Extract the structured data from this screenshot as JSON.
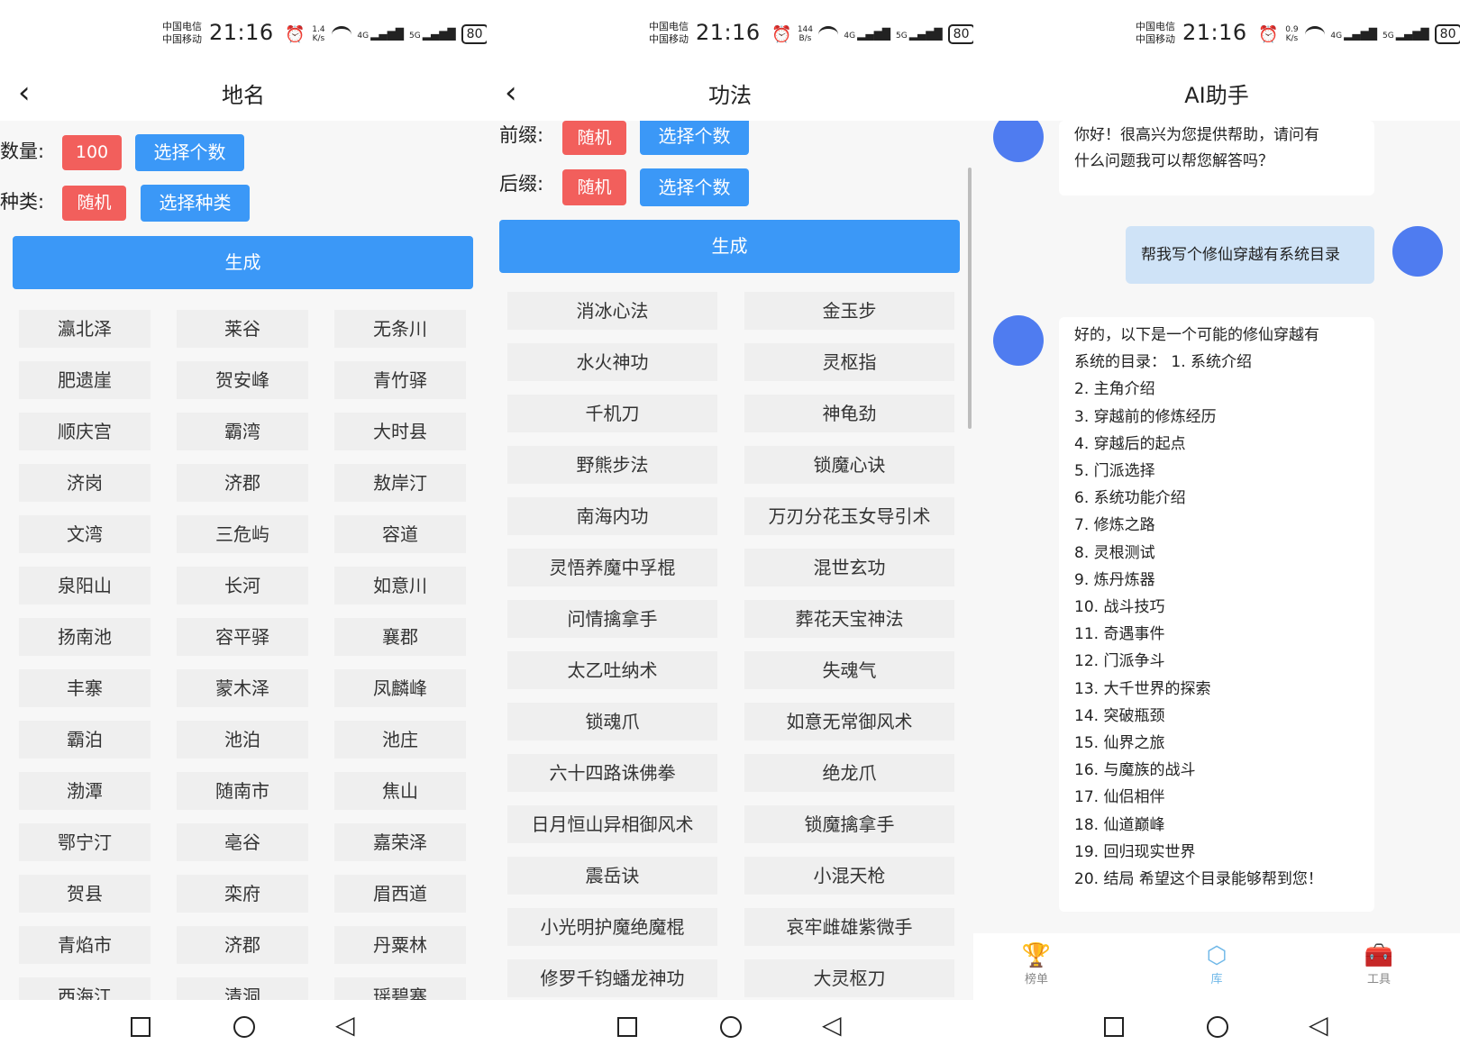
{
  "status_bar": {
    "carrier_1": "中国电信",
    "carrier_2": "中国移动",
    "time": "21:16",
    "battery": "80",
    "net_1": "4G",
    "net_2": "5G",
    "speeds": [
      "1.4 K/s",
      "144 B/s",
      "0.9 K/s"
    ]
  },
  "panel_place_names": {
    "title": "地名",
    "count_label": "数量:",
    "count_value": "100",
    "count_button": "选择个数",
    "type_label": "种类:",
    "type_value": "随机",
    "type_button": "选择种类",
    "generate_button": "生成",
    "items": [
      "瀛北泽",
      "莱谷",
      "无条川",
      "肥遗崖",
      "贺安峰",
      "青竹驿",
      "顺庆宫",
      "霸湾",
      "大时县",
      "济岗",
      "济郡",
      "敖岸汀",
      "文湾",
      "三危屿",
      "容道",
      "泉阳山",
      "长河",
      "如意川",
      "扬南池",
      "容平驿",
      "襄郡",
      "丰寨",
      "蒙木泽",
      "凤麟峰",
      "霸泊",
      "池泊",
      "池庄",
      "渤潭",
      "随南市",
      "焦山",
      "鄂宁汀",
      "亳谷",
      "嘉荣泽",
      "贺县",
      "栾府",
      "眉西道",
      "青焰市",
      "济郡",
      "丹粟林",
      "西海江",
      "清洞",
      "瑶碧寨"
    ]
  },
  "panel_techniques": {
    "title": "功法",
    "prefix_label": "前缀:",
    "prefix_value": "随机",
    "prefix_button": "选择个数",
    "suffix_label": "后缀:",
    "suffix_value": "随机",
    "suffix_button": "选择个数",
    "generate_button": "生成",
    "items": [
      "消冰心法",
      "金玉步",
      "水火神功",
      "灵枢指",
      "千机刀",
      "神龟劲",
      "野熊步法",
      "锁魔心诀",
      "南海内功",
      "万刃分花玉女导引术",
      "灵悟养魔中孚棍",
      "混世玄功",
      "问情擒拿手",
      "葬花天宝神法",
      "太乙吐纳术",
      "失魂气",
      "锁魂爪",
      "如意无常御风术",
      "六十四路诛佛拳",
      "绝龙爪",
      "日月恒山异相御风术",
      "锁魔擒拿手",
      "震岳诀",
      "小混天枪",
      "小光明护魔绝魔棍",
      "哀牢雌雄紫微手",
      "修罗千钧蟠龙神功",
      "大灵枢刀"
    ]
  },
  "panel_ai": {
    "title": "AI助手",
    "msg_greeting": [
      "你好！很高兴为您提供帮助，请问有",
      "什么问题我可以帮您解答吗？"
    ],
    "msg_user": "帮我写个修仙穿越有系统目录",
    "msg_reply": [
      "好的，以下是一个可能的修仙穿越有",
      "系统的目录： 1. 系统介绍",
      "2. 主角介绍",
      "3. 穿越前的修炼经历",
      "4. 穿越后的起点",
      "5. 门派选择",
      "6. 系统功能介绍",
      "7. 修炼之路",
      "8. 灵根测试",
      "9. 炼丹炼器",
      "10. 战斗技巧",
      "11. 奇遇事件",
      "12. 门派争斗",
      "13. 大千世界的探索",
      "14. 突破瓶颈",
      "15. 仙界之旅",
      "16. 与魔族的战斗",
      "17. 仙侣相伴",
      "18. 仙道巅峰",
      "19. 回归现实世界",
      "20. 结局 希望这个目录能够帮到您！"
    ],
    "tabs": [
      {
        "label": "榜单",
        "icon": "trophy-icon"
      },
      {
        "label": "库",
        "icon": "library-icon"
      },
      {
        "label": "工具",
        "icon": "toolbox-icon"
      }
    ]
  },
  "colors": {
    "primary_blue": "#3b98f7",
    "random_red": "#f25f5c",
    "avatar_blue": "#4f7cf0",
    "user_bubble": "#cfe3f7",
    "active_tab": "#6fb8e8"
  }
}
